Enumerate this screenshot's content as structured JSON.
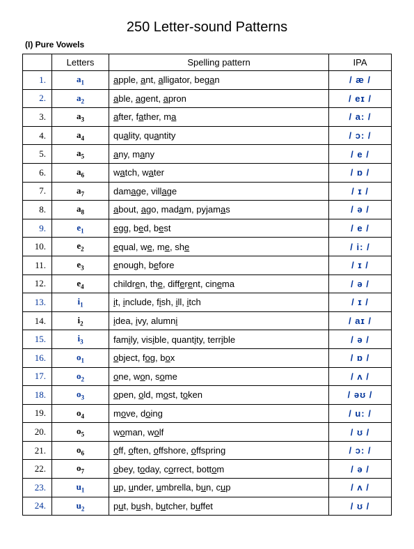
{
  "title": "250 Letter-sound Patterns",
  "subhead": "(I) Pure Vowels",
  "headers": {
    "num": "",
    "letters": "Letters",
    "pattern": "Spelling pattern",
    "ipa": "IPA"
  },
  "rows": [
    {
      "n": "1.",
      "blue": true,
      "letter": "a",
      "sub": "1",
      "ipa": "/ æ /",
      "words": [
        {
          "pre": "",
          "u": "a",
          "post": "pple"
        },
        {
          "pre": "",
          "u": "a",
          "post": "nt"
        },
        {
          "pre": "",
          "u": "a",
          "post": "lligator"
        },
        {
          "pre": "beg",
          "u": "a",
          "post": "n"
        }
      ]
    },
    {
      "n": "2.",
      "blue": true,
      "letter": "a",
      "sub": "2",
      "ipa": "/ eɪ /",
      "words": [
        {
          "pre": "",
          "u": "a",
          "post": "ble"
        },
        {
          "pre": "",
          "u": "a",
          "post": "gent"
        },
        {
          "pre": "",
          "u": "a",
          "post": "pron"
        }
      ]
    },
    {
      "n": "3.",
      "blue": false,
      "letter": "a",
      "sub": "3",
      "ipa": "/ a: /",
      "words": [
        {
          "pre": "",
          "u": "a",
          "post": "fter"
        },
        {
          "pre": "f",
          "u": "a",
          "post": "ther"
        },
        {
          "pre": "m",
          "u": "a",
          "post": ""
        }
      ]
    },
    {
      "n": "4.",
      "blue": false,
      "letter": "a",
      "sub": "4",
      "ipa": "/ ɔ: /",
      "words": [
        {
          "pre": "qu",
          "u": "a",
          "post": "lity"
        },
        {
          "pre": "qu",
          "u": "a",
          "post": "ntity"
        }
      ]
    },
    {
      "n": "5.",
      "blue": false,
      "letter": "a",
      "sub": "5",
      "ipa": "/ e /",
      "words": [
        {
          "pre": "",
          "u": "a",
          "post": "ny"
        },
        {
          "pre": "m",
          "u": "a",
          "post": "ny"
        }
      ]
    },
    {
      "n": "6.",
      "blue": false,
      "letter": "a",
      "sub": "6",
      "ipa": "/ ɒ /",
      "words": [
        {
          "pre": "w",
          "u": "a",
          "post": "tch"
        },
        {
          "pre": "w",
          "u": "a",
          "post": "ter"
        }
      ]
    },
    {
      "n": "7.",
      "blue": false,
      "letter": "a",
      "sub": "7",
      "ipa": "/ ɪ /",
      "words": [
        {
          "pre": "dam",
          "u": "a",
          "post": "ge"
        },
        {
          "pre": "vill",
          "u": "a",
          "post": "ge"
        }
      ]
    },
    {
      "n": "8.",
      "blue": false,
      "letter": "a",
      "sub": "8",
      "ipa": "/ ə /",
      "words": [
        {
          "pre": "",
          "u": "a",
          "post": "bout"
        },
        {
          "pre": "",
          "u": "a",
          "post": "go"
        },
        {
          "pre": "mad",
          "u": "a",
          "post": "m"
        },
        {
          "pre": "pyjam",
          "u": "a",
          "post": "s"
        }
      ]
    },
    {
      "n": "9.",
      "blue": true,
      "letter": "e",
      "sub": "1",
      "ipa": "/ e /",
      "words": [
        {
          "pre": "",
          "u": "e",
          "post": "gg"
        },
        {
          "pre": "b",
          "u": "e",
          "post": "d"
        },
        {
          "pre": "b",
          "u": "e",
          "post": "st"
        }
      ]
    },
    {
      "n": "10.",
      "blue": false,
      "letter": "e",
      "sub": "2",
      "ipa": "/ i: /",
      "words": [
        {
          "pre": "",
          "u": "e",
          "post": "qual"
        },
        {
          "pre": "w",
          "u": "e",
          "post": ""
        },
        {
          "pre": "m",
          "u": "e",
          "post": ""
        },
        {
          "pre": "sh",
          "u": "e",
          "post": ""
        }
      ]
    },
    {
      "n": "11.",
      "blue": false,
      "letter": "e",
      "sub": "3",
      "ipa": "/ ɪ /",
      "words": [
        {
          "pre": "",
          "u": "e",
          "post": "nough"
        },
        {
          "pre": "b",
          "u": "e",
          "post": "fore"
        }
      ]
    },
    {
      "n": "12.",
      "blue": false,
      "letter": "e",
      "sub": "4",
      "ipa": "/ ə /",
      "words": [
        {
          "pre": "childr",
          "u": "e",
          "post": "n"
        },
        {
          "pre": "th",
          "u": "e",
          "post": ""
        },
        {
          "pre": "diff",
          "u": "e",
          "post": "r"
        },
        {
          "pre": "",
          "u": "e",
          "post": "nt",
          "raw": "different"
        },
        {
          "pre": "cin",
          "u": "e",
          "post": "ma"
        }
      ],
      "rawpattern": "childr<u>e</u>n, th<u>e</u>, diff<u>e</u>r<u>e</u>nt, cin<u>e</u>ma"
    },
    {
      "n": "13.",
      "blue": true,
      "letter": "i",
      "sub": "1",
      "ipa": "/ ɪ /",
      "words": [
        {
          "pre": "",
          "u": "i",
          "post": "t"
        },
        {
          "pre": "",
          "u": "i",
          "post": "nclude"
        },
        {
          "pre": "f",
          "u": "i",
          "post": "sh"
        },
        {
          "pre": "",
          "u": "i",
          "post": "ll"
        },
        {
          "pre": "",
          "u": "i",
          "post": "tch"
        }
      ]
    },
    {
      "n": "14.",
      "blue": false,
      "letter": "i",
      "sub": "2",
      "ipa": "/ aɪ /",
      "words": [
        {
          "pre": "",
          "u": "i",
          "post": "dea"
        },
        {
          "pre": "",
          "u": "i",
          "post": "vy"
        },
        {
          "pre": "alumn",
          "u": "i",
          "post": ""
        }
      ]
    },
    {
      "n": "15.",
      "blue": true,
      "letter": "i",
      "sub": "3",
      "ipa": "/ ə /",
      "words": [
        {
          "pre": "fam",
          "u": "i",
          "post": "ly"
        },
        {
          "pre": "vis",
          "u": "i",
          "post": "ble"
        },
        {
          "pre": "quant",
          "u": "i",
          "post": "ty"
        },
        {
          "pre": "terr",
          "u": "i",
          "post": "ble"
        }
      ]
    },
    {
      "n": "16.",
      "blue": true,
      "letter": "o",
      "sub": "1",
      "ipa": "/ ɒ /",
      "words": [
        {
          "pre": "",
          "u": "o",
          "post": "bject"
        },
        {
          "pre": "f",
          "u": "o",
          "post": "g"
        },
        {
          "pre": "b",
          "u": "o",
          "post": "x"
        }
      ]
    },
    {
      "n": "17.",
      "blue": true,
      "letter": "o",
      "sub": "2",
      "ipa": "/ ʌ /",
      "words": [
        {
          "pre": "",
          "u": "o",
          "post": "ne"
        },
        {
          "pre": "w",
          "u": "o",
          "post": "n"
        },
        {
          "pre": "s",
          "u": "o",
          "post": "me"
        }
      ]
    },
    {
      "n": "18.",
      "blue": true,
      "letter": "o",
      "sub": "3",
      "ipa": "/ əʊ /",
      "words": [
        {
          "pre": "",
          "u": "o",
          "post": "pen"
        },
        {
          "pre": "",
          "u": "o",
          "post": "ld"
        },
        {
          "pre": "m",
          "u": "o",
          "post": "st"
        },
        {
          "pre": "t",
          "u": "o",
          "post": "ken"
        }
      ]
    },
    {
      "n": "19.",
      "blue": false,
      "letter": "o",
      "sub": "4",
      "ipa": "/ u: /",
      "words": [
        {
          "pre": "m",
          "u": "o",
          "post": "ve"
        },
        {
          "pre": "d",
          "u": "o",
          "post": "ing"
        }
      ]
    },
    {
      "n": "20.",
      "blue": false,
      "letter": "o",
      "sub": "5",
      "ipa": "/ ʊ /",
      "words": [
        {
          "pre": "w",
          "u": "o",
          "post": "man"
        },
        {
          "pre": "w",
          "u": "o",
          "post": "lf"
        }
      ]
    },
    {
      "n": "21.",
      "blue": false,
      "letter": "o",
      "sub": "6",
      "ipa": "/ ɔ: /",
      "words": [
        {
          "pre": "",
          "u": "o",
          "post": "ff"
        },
        {
          "pre": "",
          "u": "o",
          "post": "ften"
        },
        {
          "pre": "",
          "u": "o",
          "post": "ffshore"
        },
        {
          "pre": "",
          "u": "o",
          "post": "ffspring"
        }
      ]
    },
    {
      "n": "22.",
      "blue": false,
      "letter": "o",
      "sub": "7",
      "ipa": "/ ə /",
      "words": [
        {
          "pre": "",
          "u": "o",
          "post": "bey"
        },
        {
          "pre": "t",
          "u": "o",
          "post": "day"
        },
        {
          "pre": "c",
          "u": "o",
          "post": "rrect"
        },
        {
          "pre": "bott",
          "u": "o",
          "post": "m"
        }
      ]
    },
    {
      "n": "23.",
      "blue": true,
      "letter": "u",
      "sub": "1",
      "ipa": "/ ʌ /",
      "words": [
        {
          "pre": "",
          "u": "u",
          "post": "p"
        },
        {
          "pre": "",
          "u": "u",
          "post": "nder"
        },
        {
          "pre": "",
          "u": "u",
          "post": "mbrella"
        },
        {
          "pre": "b",
          "u": "u",
          "post": "n"
        },
        {
          "pre": "c",
          "u": "u",
          "post": "p"
        }
      ]
    },
    {
      "n": "24.",
      "blue": true,
      "letter": "u",
      "sub": "2",
      "ipa": "/ ʊ /",
      "words": [
        {
          "pre": "p",
          "u": "u",
          "post": "t"
        },
        {
          "pre": "b",
          "u": "u",
          "post": "sh"
        },
        {
          "pre": "b",
          "u": "u",
          "post": "tcher"
        },
        {
          "pre": "b",
          "u": "u",
          "post": "ffet"
        }
      ]
    }
  ]
}
